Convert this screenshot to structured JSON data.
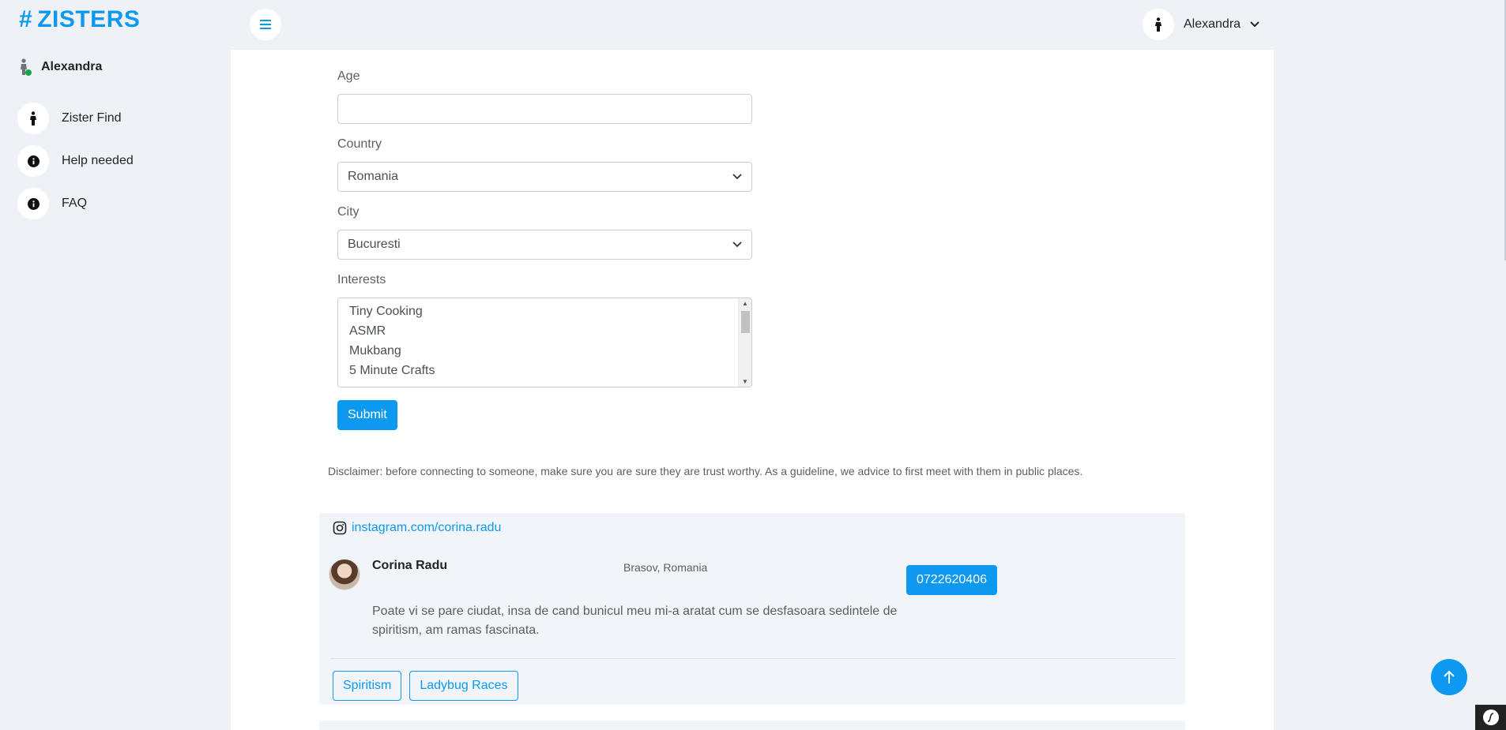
{
  "brand": {
    "hash": "#",
    "name": "ZISTERS"
  },
  "sidebar": {
    "user_name": "Alexandra",
    "items": [
      {
        "label": "Zister Find",
        "icon": "person-icon"
      },
      {
        "label": "Help needed",
        "icon": "info-icon"
      },
      {
        "label": "FAQ",
        "icon": "info-icon"
      }
    ]
  },
  "topbar": {
    "user_name": "Alexandra"
  },
  "form": {
    "age_label": "Age",
    "age_value": "",
    "country_label": "Country",
    "country_value": "Romania",
    "city_label": "City",
    "city_value": "Bucuresti",
    "interests_label": "Interests",
    "interests_options": [
      "Tiny Cooking",
      "ASMR",
      "Mukbang",
      "5 Minute Crafts"
    ],
    "submit_label": "Submit"
  },
  "disclaimer": "Disclaimer: before connecting to someone, make sure you are sure they are trust worthy. As a guideline, we advice to first meet with them in public places.",
  "profile": {
    "instagram": "instagram.com/corina.radu",
    "name": "Corina Radu",
    "location": "Brasov, Romania",
    "phone": "0722620406",
    "bio": "Poate vi se pare ciudat, insa de cand bunicul meu mi-a aratat cum se desfasoara sedintele de spiritism, am ramas fascinata.",
    "tags": [
      "Spiritism",
      "Ladybug Races"
    ]
  },
  "colors": {
    "accent": "#0d99f0",
    "background": "#eef2f7",
    "card": "#f1f4f8"
  }
}
